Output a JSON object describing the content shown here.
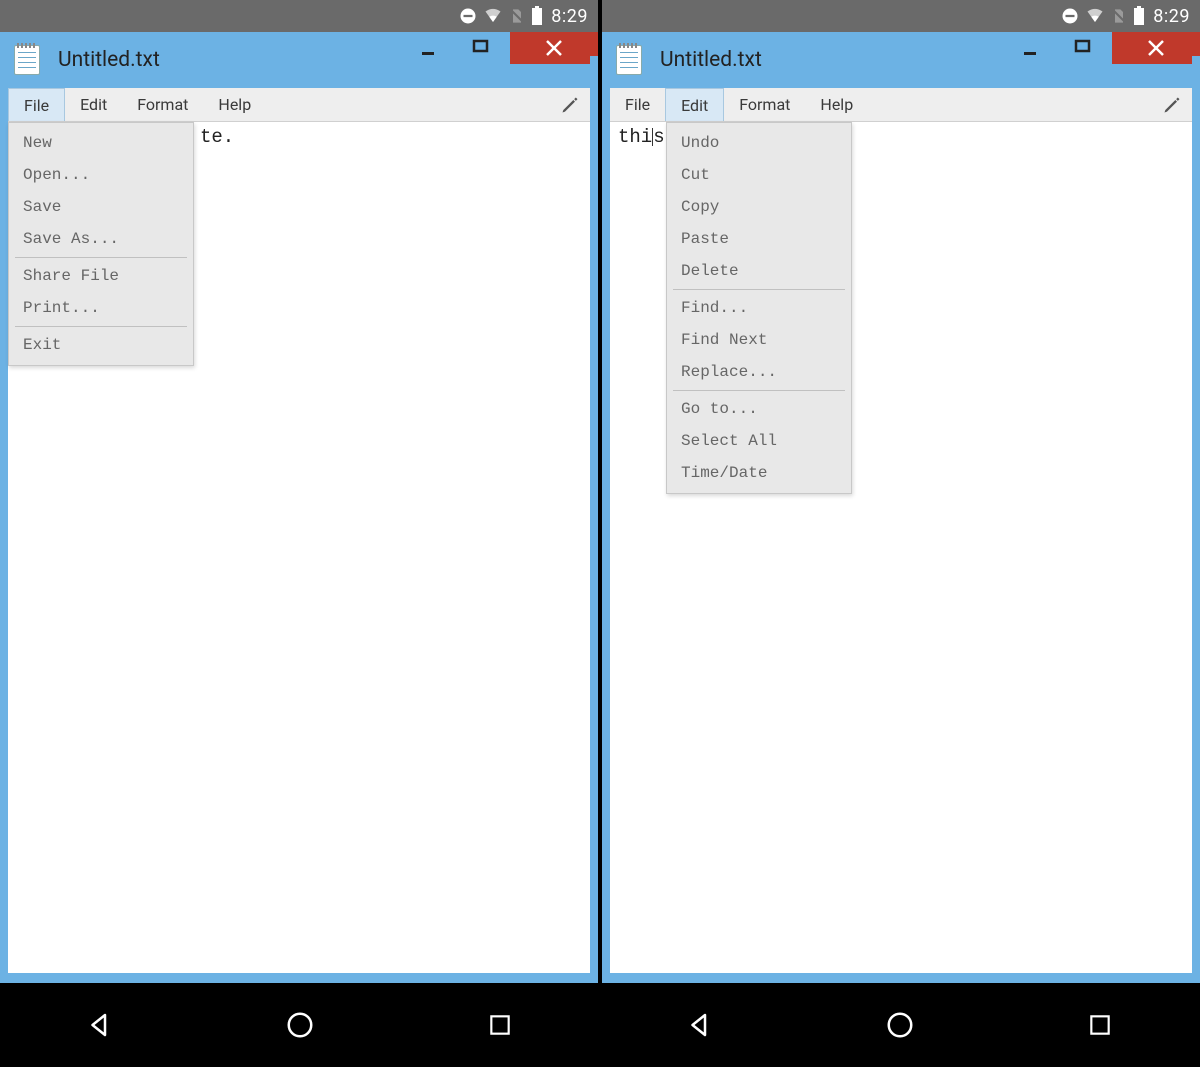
{
  "status": {
    "time": "8:29"
  },
  "left": {
    "title": "Untitled.txt",
    "menus": {
      "file": "File",
      "edit": "Edit",
      "format": "Format",
      "help": "Help"
    },
    "active_menu": "file",
    "editor_visible": "te.",
    "dropdown": {
      "groups": [
        [
          "New",
          "Open...",
          "Save",
          "Save As..."
        ],
        [
          "Share File",
          "Print..."
        ],
        [
          "Exit"
        ]
      ]
    }
  },
  "right": {
    "title": "Untitled.txt",
    "menus": {
      "file": "File",
      "edit": "Edit",
      "format": "Format",
      "help": "Help"
    },
    "active_menu": "edit",
    "editor_before": "thi",
    "editor_after": "s",
    "dropdown": {
      "groups": [
        [
          "Undo",
          "Cut",
          "Copy",
          "Paste",
          "Delete"
        ],
        [
          "Find...",
          "Find Next",
          "Replace..."
        ],
        [
          "Go to...",
          "Select All",
          "Time/Date"
        ]
      ]
    }
  }
}
